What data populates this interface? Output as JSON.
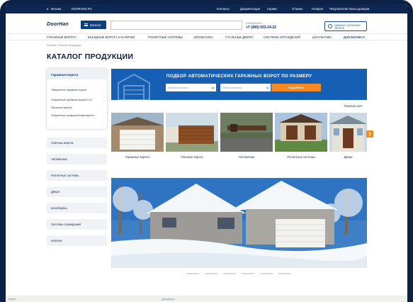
{
  "topbar": {
    "city": "Москва",
    "site": "DOORHAN.RU",
    "links": [
      "Контакты",
      "Документация",
      "Сервис",
      "Отзывы",
      "Галерея",
      "Покупателям",
      "Поиск дилеров"
    ]
  },
  "header": {
    "logo": "DoorHan",
    "catalog_label": "Каталог",
    "search_placeholder": "",
    "phone_label": "ЕЖЕДНЕВНО",
    "phone": "+7 (495) 933-24-22",
    "callback_label": "ЗАКАЗАТЬ ОБРАТНЫЙ ЗВОНОК"
  },
  "nav": [
    "ГАРАЖНЫЕ ВОРОТА",
    "ВЪЕЗДНЫЕ ВОРОТА И КАЛИТКИ",
    "РОЛЛЕТНЫЕ СИСТЕМЫ",
    "АВТОМАТИКА",
    "СТАЛЬНЫЕ ДВЕРИ",
    "СИСТЕМЫ ОГРАЖДЕНИЙ",
    "ШЛАГБАУМЫ",
    "ДЛЯ БИЗНЕСА"
  ],
  "breadcrumbs": "Главная › Каталог продукции",
  "page_title": "КАТАЛОГ ПРОДУКЦИИ",
  "sidebar": {
    "open_title": "Гаражные ворота",
    "sub_items": [
      "Секционные гаражные ворота",
      "Секционные гаражные ворота LUX",
      "Рулонные ворота",
      "Секционные промышленные ворота"
    ],
    "items": [
      "Уличные ворота",
      "Автоматика",
      "Роллетные системы",
      "Двери",
      "Шлагбаумы",
      "Системы ограждений",
      "Калитки"
    ]
  },
  "banner": {
    "title": "ПОДБОР АВТОМАТИЧЕСКИХ ГАРАЖНЫХ ВОРОТ ПО РАЗМЕРУ",
    "width_placeholder": "Ширина проема",
    "height_placeholder": "Высота проема",
    "button": "ПОДОБРАТЬ"
  },
  "show_all": "Показать всё",
  "categories": [
    "Гаражные ворота",
    "Уличные ворота",
    "Автоматика",
    "Роллетные системы",
    "Двери"
  ],
  "map": {
    "labels": [
      "Видное",
      "Домодедово"
    ]
  },
  "colors": {
    "brand_dark": "#0e2751",
    "brand_blue": "#1560b5",
    "accent_orange": "#f6891f"
  }
}
